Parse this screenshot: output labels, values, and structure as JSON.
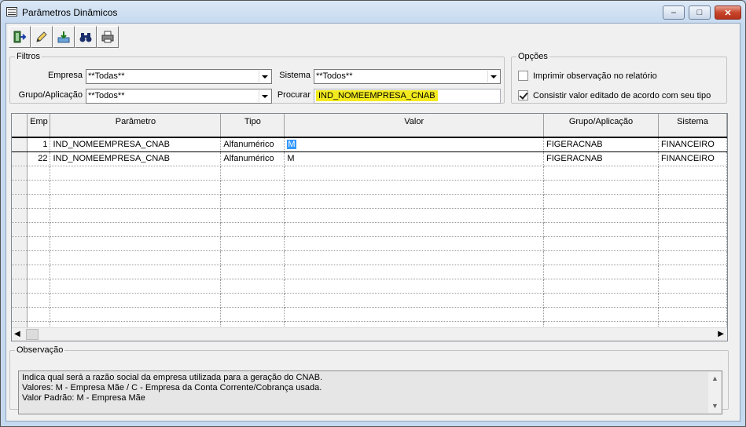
{
  "window": {
    "title": "Parâmetros Dinâmicos",
    "min_glyph": "–",
    "max_glyph": "□",
    "close_glyph": "✕"
  },
  "toolbar": {
    "buttons": [
      {
        "icon": "exit-icon"
      },
      {
        "icon": "edit-pencil-icon"
      },
      {
        "icon": "import-icon"
      },
      {
        "icon": "binoculars-icon"
      },
      {
        "icon": "printer-icon"
      }
    ]
  },
  "filtros": {
    "legend": "Filtros",
    "empresa_label": "Empresa",
    "empresa_value": "**Todas**",
    "sistema_label": "Sistema",
    "sistema_value": "**Todos**",
    "grupo_label": "Grupo/Aplicação",
    "grupo_value": "**Todos**",
    "procurar_label": "Procurar",
    "procurar_value": "IND_NOMEEMPRESA_CNAB",
    "highlight_color": "#f2ea1e"
  },
  "opcoes": {
    "legend": "Opções",
    "imprimir_label": "Imprimir observação no relatório",
    "imprimir_checked": false,
    "consistir_label": "Consistir valor editado de acordo com seu tipo",
    "consistir_checked": true
  },
  "grid": {
    "columns": [
      "Emp",
      "Parâmetro",
      "Tipo",
      "Valor",
      "Grupo/Aplicação",
      "Sistema"
    ],
    "rows": [
      {
        "emp": "1",
        "parametro": "IND_NOMEEMPRESA_CNAB",
        "tipo": "Alfanumérico",
        "valor": "M",
        "grupo": "FIGERACNAB",
        "sistema": "FINANCEIRO"
      },
      {
        "emp": "22",
        "parametro": "IND_NOMEEMPRESA_CNAB",
        "tipo": "Alfanumérico",
        "valor": "M",
        "grupo": "FIGERACNAB",
        "sistema": "FINANCEIRO"
      }
    ],
    "selection_color": "#3399ff"
  },
  "observacao": {
    "legend": "Observação",
    "lines": [
      "Indica qual será a razão social da empresa utilizada para a geração do CNAB.",
      "Valores: M - Empresa Mãe / C - Empresa da Conta Corrente/Cobrança usada.",
      "Valor Padrão: M - Empresa Mãe"
    ]
  }
}
